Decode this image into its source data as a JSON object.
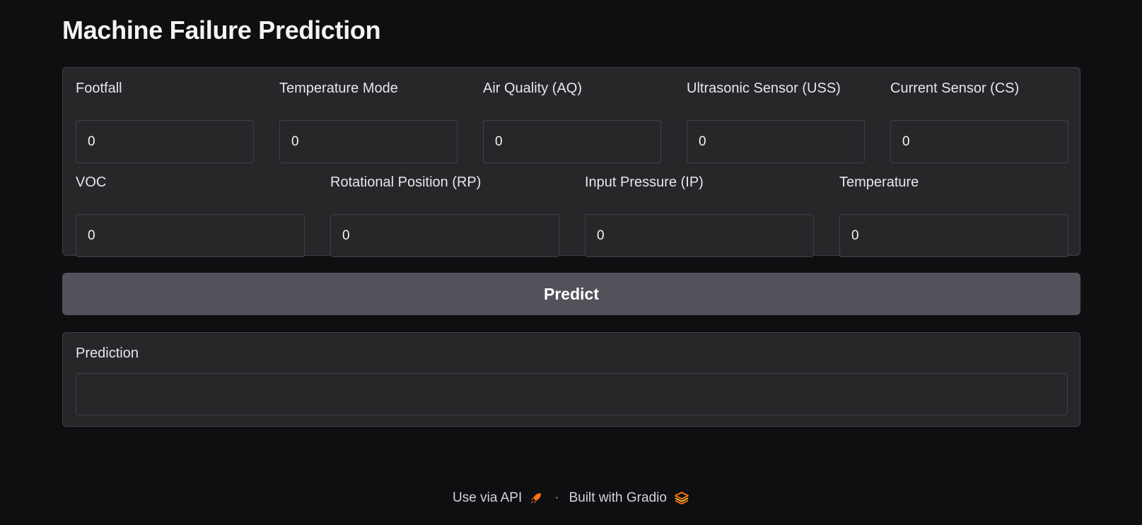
{
  "page": {
    "title": "Machine Failure Prediction"
  },
  "inputs": {
    "row1": [
      {
        "label": "Footfall",
        "value": "0"
      },
      {
        "label": "Temperature Mode",
        "value": "0"
      },
      {
        "label": "Air Quality (AQ)",
        "value": "0"
      },
      {
        "label": "Ultrasonic Sensor (USS)",
        "value": "0"
      },
      {
        "label": "Current Sensor (CS)",
        "value": "0"
      }
    ],
    "row2": [
      {
        "label": "VOC",
        "value": "0"
      },
      {
        "label": "Rotational Position (RP)",
        "value": "0"
      },
      {
        "label": "Input Pressure (IP)",
        "value": "0"
      },
      {
        "label": "Temperature",
        "value": "0"
      }
    ]
  },
  "predict_button": {
    "label": "Predict"
  },
  "output": {
    "label": "Prediction",
    "value": ""
  },
  "footer": {
    "api_link": "Use via API",
    "api_icon": "rocket-icon",
    "separator": "·",
    "built_with": "Built with Gradio",
    "gradio_icon": "gradio-logo-icon"
  },
  "colors": {
    "background": "#0f0f11",
    "panel": "#27272a",
    "border": "#3f3f46",
    "button": "#52525b",
    "accent": "#f97316"
  }
}
